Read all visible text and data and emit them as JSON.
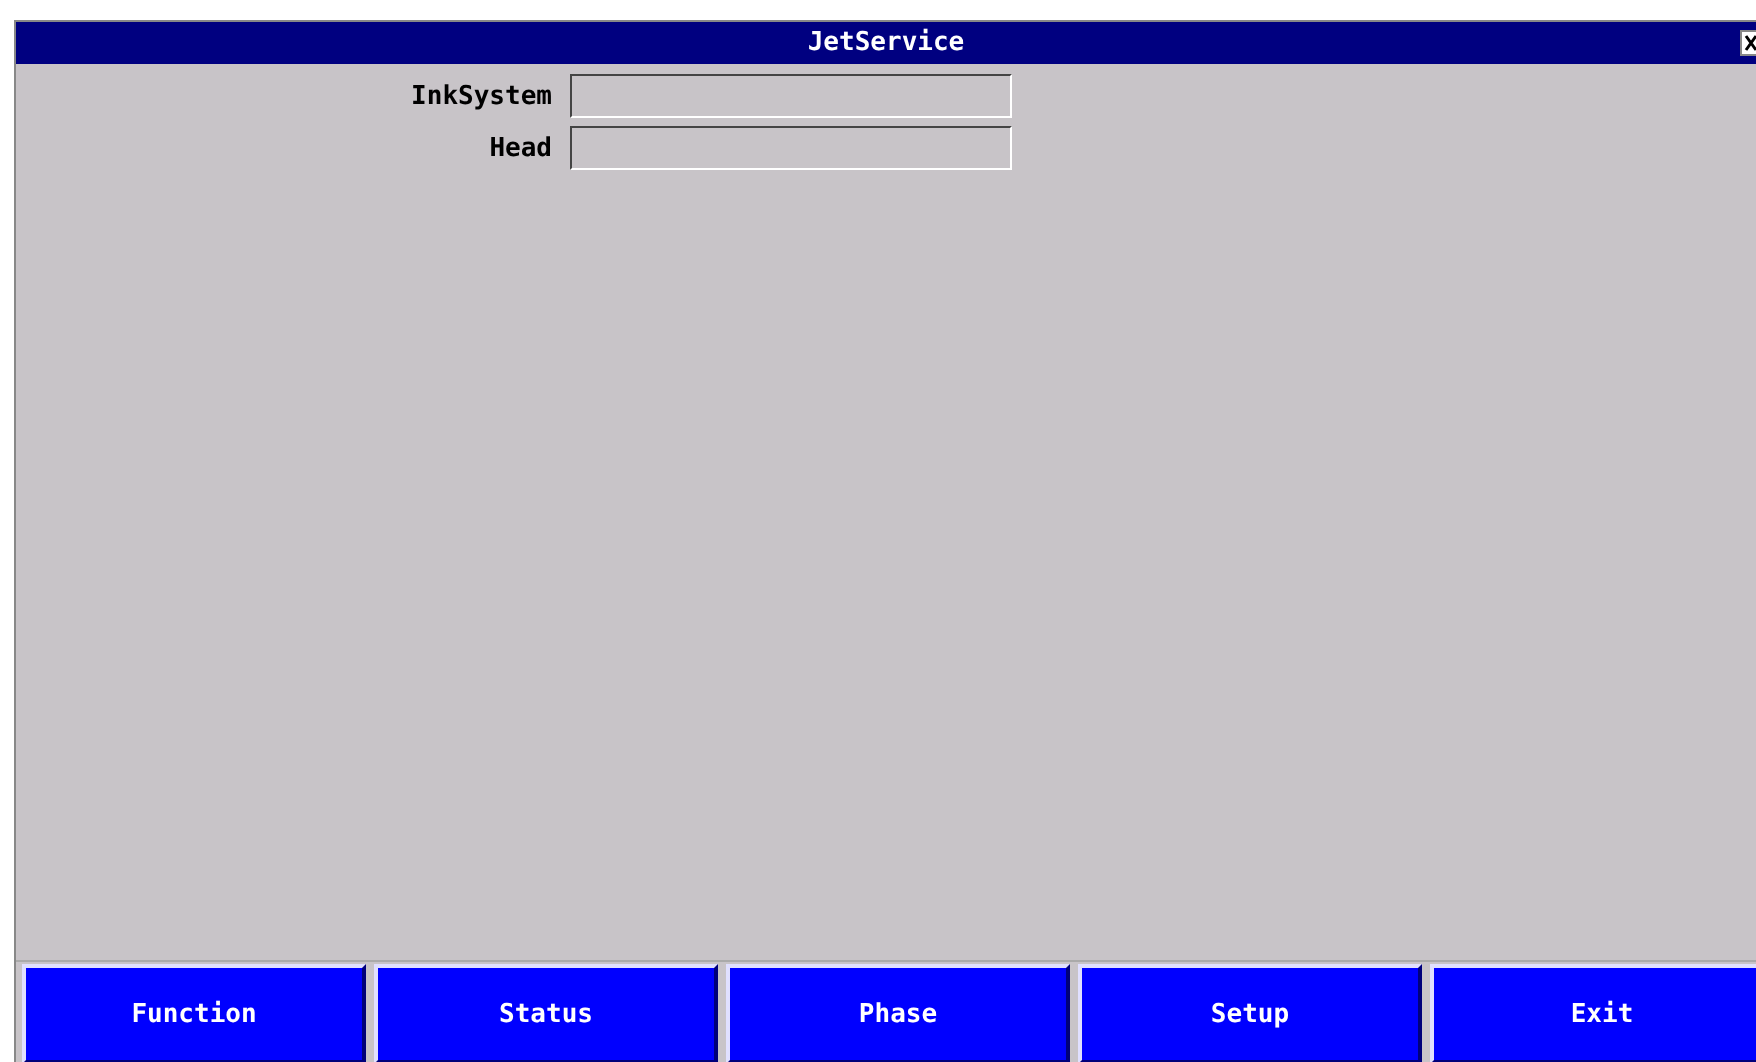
{
  "window": {
    "title": "JetService"
  },
  "fields": [
    {
      "label": "InkSystem"
    },
    {
      "label": "Head"
    }
  ],
  "buttons": [
    {
      "label": "Function"
    },
    {
      "label": "Status"
    },
    {
      "label": "Phase"
    },
    {
      "label": "Setup"
    },
    {
      "label": "Exit"
    }
  ]
}
